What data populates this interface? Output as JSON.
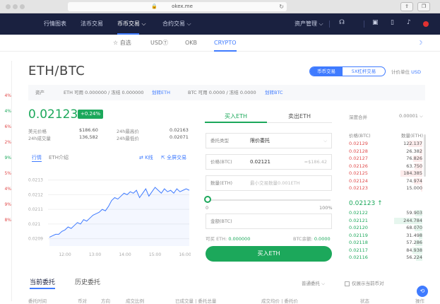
{
  "browser": {
    "url": "okex.me",
    "lock": "🔒",
    "reload": "↻",
    "share": "⇪",
    "tabs_btn": "❐"
  },
  "nav": {
    "items": [
      {
        "label": "行情图表"
      },
      {
        "label": "法币交易"
      },
      {
        "label": "币币交易 ⌵",
        "active": true
      },
      {
        "label": "合约交易 ⌵"
      }
    ],
    "right": {
      "asset_mgmt": "资产管理 ⌵"
    }
  },
  "subnav": {
    "tabs": [
      {
        "label": "☆ 自选"
      },
      {
        "label": "USDⓉ"
      },
      {
        "label": "OKB"
      },
      {
        "label": "CRYPTO",
        "active": true
      }
    ],
    "night_icon": "☽"
  },
  "left_strip": {
    "percents": [
      {
        "text": "4%",
        "color": "red"
      },
      {
        "text": "4%",
        "color": "green"
      },
      {
        "text": "6%",
        "color": "red"
      },
      {
        "text": "2%",
        "color": "red"
      },
      {
        "text": "9%",
        "color": "green"
      },
      {
        "text": "5%",
        "color": "red"
      },
      {
        "text": "4%",
        "color": "red"
      },
      {
        "text": "9%",
        "color": "red"
      },
      {
        "text": "8%",
        "color": "red"
      }
    ]
  },
  "pair": {
    "name": "ETH/BTC",
    "mode_spot": "币币交易",
    "mode_margin": "5X杠杆交易",
    "unit_label": "计价单位",
    "unit_value": "USD"
  },
  "assets": {
    "label": "资产",
    "eth": "ETH  可用 0.000000 / 冻结 0.000000",
    "eth_link": "划转ETH",
    "btc": "BTC  可用 0.0000 / 冻结 0.0000",
    "btc_link": "划转BTC"
  },
  "ticker": {
    "price": "0.02123",
    "change": "+0.24%",
    "fiat_label": "美元价格",
    "fiat_value": "$186.60",
    "vol_label": "24h成交量",
    "vol_value": "136,582",
    "high_label": "24h最高价",
    "high_value": "0.02163",
    "low_label": "24h最低价",
    "low_value": "0.02071"
  },
  "chart_tabs": {
    "market": "行情",
    "intro": "ETH介绍",
    "kline": "⇄ K线",
    "depth": "⇱ 全屏交易"
  },
  "chart_data": {
    "type": "line",
    "y_ticks": [
      "0.0213",
      "0.0212",
      "0.0211",
      "0.021",
      "0.0209"
    ],
    "x_ticks": [
      "12:00",
      "13:00",
      "14:00",
      "15:00",
      "16:00"
    ],
    "ylim": [
      0.02085,
      0.02138
    ],
    "values": [
      0.02091,
      0.02092,
      0.02093,
      0.02093,
      0.02095,
      0.02096,
      0.02098,
      0.02097,
      0.02099,
      0.02101,
      0.021,
      0.02103,
      0.02102,
      0.02104,
      0.02106,
      0.02107,
      0.02108,
      0.0211,
      0.02109,
      0.02112,
      0.02116,
      0.02118,
      0.02117,
      0.02119,
      0.02121,
      0.0212,
      0.02122,
      0.02121,
      0.02123,
      0.02118,
      0.02121,
      0.02124,
      0.02119,
      0.02122,
      0.02125,
      0.02123,
      0.02121,
      0.02124,
      0.02122,
      0.02123,
      0.02121,
      0.02124,
      0.02122,
      0.02123,
      0.02124,
      0.02123
    ],
    "color": "#3f7bff"
  },
  "order_form": {
    "buy_tab": "买入ETH",
    "sell_tab": "卖出ETH",
    "type_label": "委托类型",
    "type_value": "限价委托",
    "price_label": "价格(BTC)",
    "price_value": "0.02121",
    "price_hint": "≈$186.42",
    "qty_label": "数量(ETH)",
    "qty_placeholder": "最小交易数量0.001ETH",
    "slider_min": "0",
    "slider_max": "100%",
    "amount_label": "金额(BTC)",
    "avail_eth_label": "可买 ETH:",
    "avail_eth": "0.000000",
    "avail_btc_label": "BTC余额:",
    "avail_btc": "0.0000",
    "submit": "买入ETH"
  },
  "orderbook": {
    "depth_label": "深度合并",
    "depth_value": "0.00001 ⌵",
    "price_head": "价格(BTC)",
    "qty_head": "数量(ETH)",
    "asks": [
      {
        "p": "0.02129",
        "q": "122.137"
      },
      {
        "p": "0.02128",
        "q": "26.382"
      },
      {
        "p": "0.02127",
        "q": "76.826"
      },
      {
        "p": "0.02126",
        "q": "63.750"
      },
      {
        "p": "0.02125",
        "q": "184.385"
      },
      {
        "p": "0.02124",
        "q": "74.974"
      },
      {
        "p": "0.02123",
        "q": "15.000"
      }
    ],
    "mid": "0.02123 ↑",
    "bids": [
      {
        "p": "0.02122",
        "q": "59.903"
      },
      {
        "p": "0.02121",
        "q": "244.784"
      },
      {
        "p": "0.02120",
        "q": "68.070"
      },
      {
        "p": "0.02119",
        "q": "31.498"
      },
      {
        "p": "0.02118",
        "q": "57.286"
      },
      {
        "p": "0.02117",
        "q": "84.938"
      },
      {
        "p": "0.02116",
        "q": "56.224"
      }
    ]
  },
  "bottom": {
    "tab_current": "当前委托",
    "tab_history": "历史委托",
    "filter": "普通委托 ⌵",
    "only_pair": "仅展示当前币对",
    "cols": [
      "委托时间",
      "币对",
      "方向",
      "成交比例",
      "已成交量 | 委托总量",
      "成交均价 | 委托价",
      "状态",
      "操作"
    ]
  },
  "colors": {
    "nav_bg": "#1a2140",
    "accent": "#3f7bff",
    "up": "#1ca85b",
    "down": "#e04a4a"
  }
}
